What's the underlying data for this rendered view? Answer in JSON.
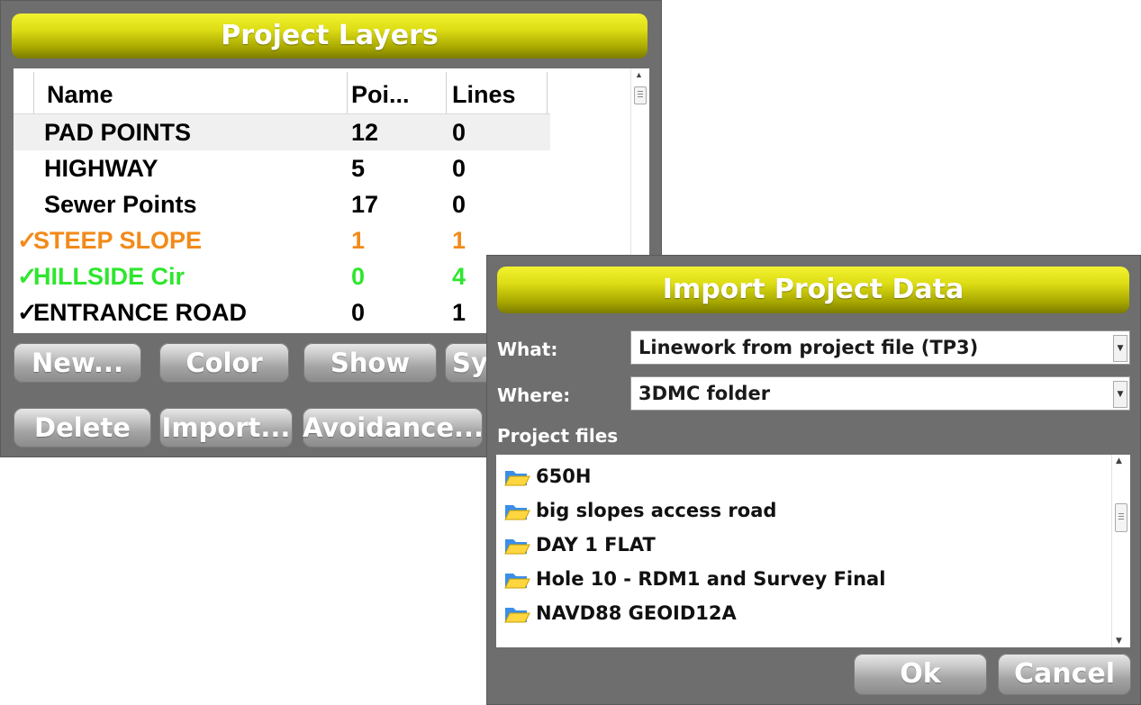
{
  "layers_window": {
    "title": "Project Layers",
    "columns": {
      "name": "Name",
      "points": "Poi...",
      "lines": "Lines"
    },
    "rows": [
      {
        "check": "",
        "name": "PAD POINTS",
        "points": "12",
        "lines": "0",
        "color": "#000000"
      },
      {
        "check": "",
        "name": "HIGHWAY",
        "points": "5",
        "lines": "0",
        "color": "#000000"
      },
      {
        "check": "",
        "name": "Sewer Points",
        "points": "17",
        "lines": "0",
        "color": "#000000"
      },
      {
        "check": "✓",
        "name": "STEEP SLOPE",
        "points": "1",
        "lines": "1",
        "color": "#f28a1a"
      },
      {
        "check": "✓",
        "name": "HILLSIDE Cir",
        "points": "0",
        "lines": "4",
        "color": "#2ee62e"
      },
      {
        "check": "✓",
        "name": "ENTRANCE ROAD",
        "points": "0",
        "lines": "1",
        "color": "#000000"
      }
    ],
    "buttons": {
      "new": "New...",
      "color": "Color",
      "show": "Show",
      "sy": "Sy",
      "delete": "Delete",
      "import": "Import...",
      "avoidance": "Avoidance..."
    }
  },
  "import_dialog": {
    "title": "Import Project Data",
    "what_label": "What:",
    "what_value": "Linework from project file (TP3)",
    "where_label": "Where:",
    "where_value": "3DMC folder",
    "files_label": "Project files",
    "files": [
      "650H",
      "big slopes access road",
      "DAY 1 FLAT",
      "Hole 10  - RDM1 and Survey Final",
      "NAVD88 GEOID12A"
    ],
    "ok": "Ok",
    "cancel": "Cancel"
  },
  "colors": {
    "title_yellow": "#dede16",
    "window_gray": "#6e6e6e",
    "orange_layer": "#f28a1a",
    "green_layer": "#2ee62e"
  }
}
